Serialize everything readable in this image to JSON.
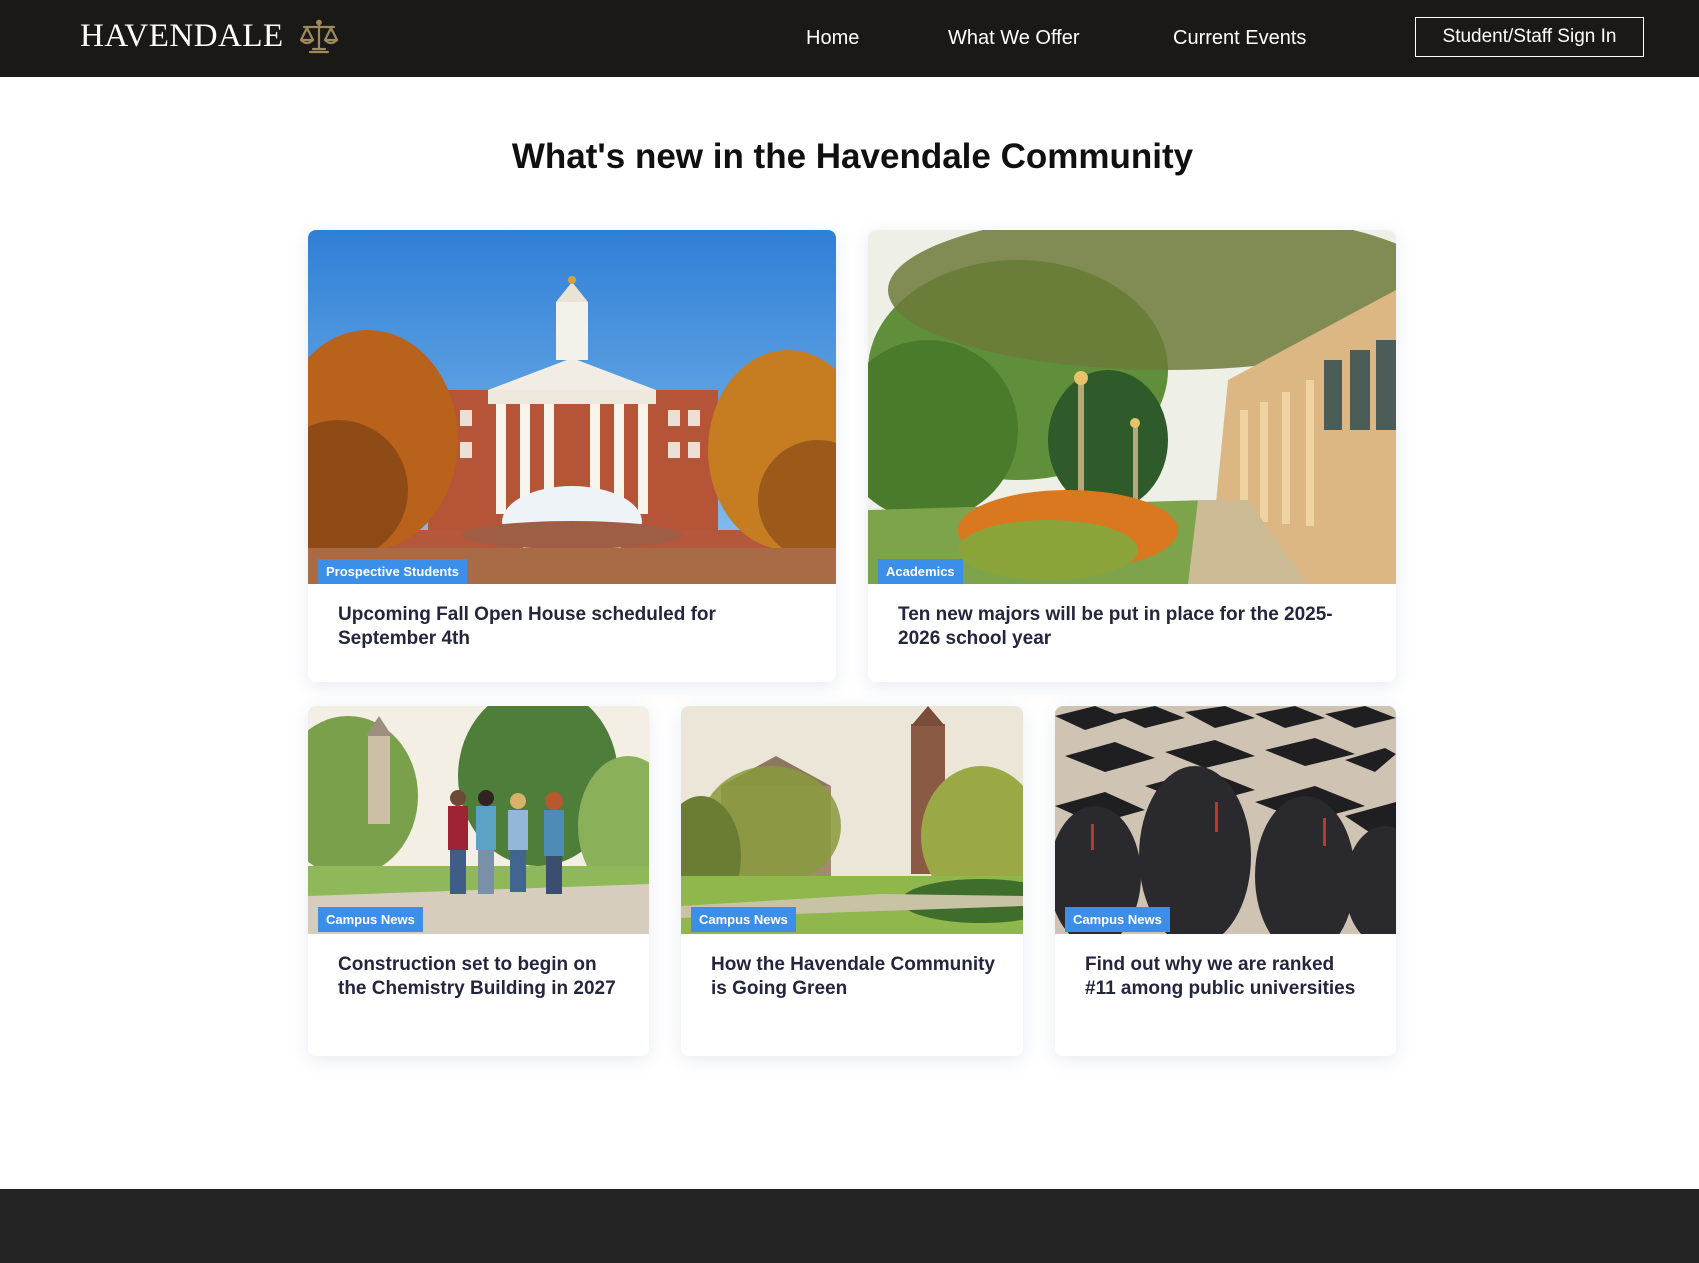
{
  "brand": {
    "name": "HAVENDALE",
    "logo_icon": "scales-of-justice-icon",
    "logo_color": "#a08a5c"
  },
  "nav": {
    "home": "Home",
    "offer": "What We Offer",
    "events": "Current Events",
    "signin": "Student/Staff Sign In"
  },
  "main": {
    "heading": "What's new in the Havendale Community"
  },
  "cards": [
    {
      "category": "Prospective Students",
      "title": "Upcoming Fall Open House scheduled for September 4th"
    },
    {
      "category": "Academics",
      "title": "Ten new majors will be put in place for the 2025-2026 school year"
    },
    {
      "category": "Campus News",
      "title": "Construction set to begin on the Chemistry Building in 2027"
    },
    {
      "category": "Campus News",
      "title": "How the Havendale Community is Going Green"
    },
    {
      "category": "Campus News",
      "title": "Find out why we are ranked #11 among public universities"
    }
  ],
  "colors": {
    "header_bg": "#1a1918",
    "badge_bg": "#3b8fe8",
    "footer_bg": "#232323",
    "title_text": "#23263d"
  }
}
